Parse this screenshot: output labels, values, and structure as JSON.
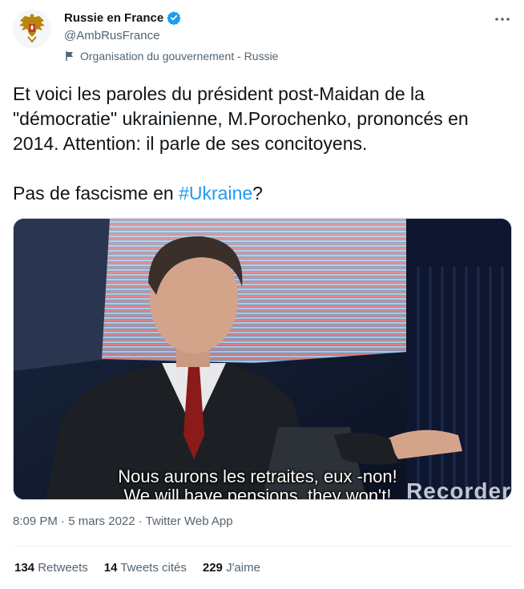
{
  "account": {
    "display_name": "Russie en France",
    "handle": "@AmbRusFrance",
    "affiliation": "Organisation du gouvernement - Russie",
    "avatar_icon": "russian-coat-of-arms-icon",
    "verified_icon": "verified-badge-icon"
  },
  "tweet": {
    "line1": "Et voici les paroles du président post-Maidan de la \"démocratie\" ukrainienne, M.Porochenko, prononcés en 2014.  Attention: il parle de ses concitoyens.",
    "line2_prefix": "Pas de fascisme en ",
    "hashtag": "#Ukraine",
    "line2_suffix": "?"
  },
  "media": {
    "subtitle_fr": "Nous aurons les retraites, eux -non!",
    "subtitle_en": "We will have pensions, they won't!",
    "watermark": "Recorder"
  },
  "meta": {
    "time": "8:09 PM",
    "date": "5 mars 2022",
    "source": "Twitter Web App",
    "separator": " · "
  },
  "stats": {
    "retweets_count": "134",
    "retweets_label": "Retweets",
    "quotes_count": "14",
    "quotes_label": "Tweets cités",
    "likes_count": "229",
    "likes_label": "J'aime"
  },
  "colors": {
    "link": "#1d9bf0",
    "secondary_text": "#536471",
    "primary_text": "#0f1419"
  }
}
